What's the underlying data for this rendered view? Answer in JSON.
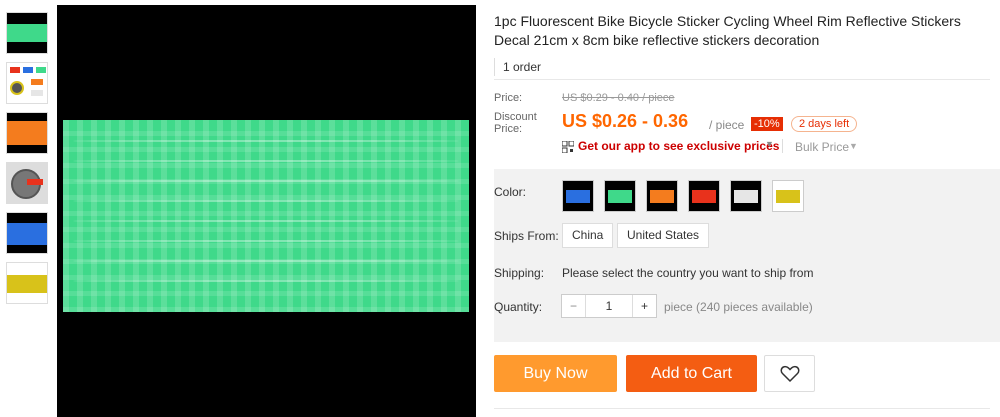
{
  "product": {
    "title": "1pc Fluorescent Bike Bicycle Sticker Cycling Wheel Rim Reflective Stickers Decal 21cm x 8cm bike reflective stickers decoration",
    "orders": "1 order"
  },
  "price": {
    "label": "Price:",
    "original": "US $0.29 - 0.40 / piece",
    "discount_label_1": "Discount",
    "discount_label_2": "Price:",
    "current": "US $0.26 - 0.36",
    "unit": "/ piece",
    "discount_badge": "-10%",
    "days_left": "2 days left",
    "app_link": "Get our app to see exclusive prices",
    "bulk_price": "Bulk Price"
  },
  "options": {
    "color_label": "Color:",
    "colors": [
      {
        "name": "blue",
        "color": "#2a6fe0"
      },
      {
        "name": "green",
        "color": "#3fd98a"
      },
      {
        "name": "orange",
        "color": "#f47c1e"
      },
      {
        "name": "red",
        "color": "#e8321c"
      },
      {
        "name": "white",
        "color": "#e6e6e6"
      },
      {
        "name": "yellow",
        "color": "#d8c21a"
      }
    ],
    "ships_from_label": "Ships From:",
    "ships_from": [
      "China",
      "United States"
    ],
    "shipping_label": "Shipping:",
    "shipping_text": "Please select the country you want to ship from",
    "quantity_label": "Quantity:",
    "quantity_value": "1",
    "quantity_minus": "−",
    "quantity_plus": "+",
    "quantity_note": "piece (240 pieces available)"
  },
  "actions": {
    "buy_now": "Buy Now",
    "add_to_cart": "Add to Cart"
  },
  "theme": {
    "accent_orange": "#ff9a2e",
    "cart_orange": "#f45d12",
    "price_color": "#f60"
  }
}
